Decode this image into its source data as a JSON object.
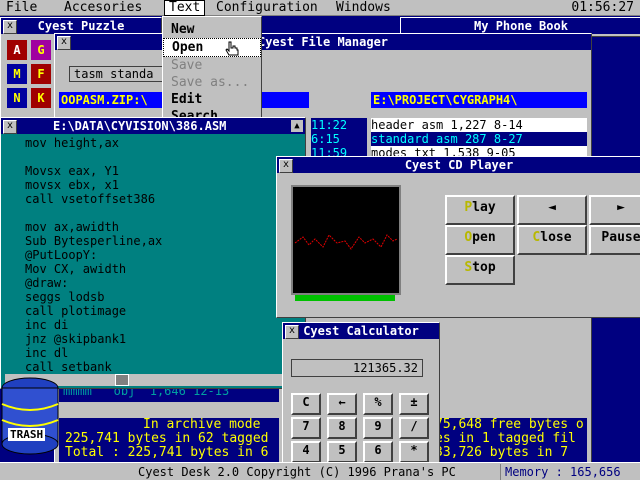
{
  "menubar": {
    "items": [
      {
        "label": "File",
        "hot": "F"
      },
      {
        "label": "Accesories",
        "hot": "A"
      },
      {
        "label": "Text",
        "hot": "T"
      },
      {
        "label": "Configuration",
        "hot": "C"
      },
      {
        "label": "Windows",
        "hot": "W"
      }
    ],
    "clock": "01:56:27"
  },
  "text_menu": {
    "items": [
      {
        "label": "New",
        "enabled": true
      },
      {
        "label": "Open",
        "enabled": true
      },
      {
        "label": "Save",
        "enabled": false
      },
      {
        "label": "Save as...",
        "enabled": false
      },
      {
        "label": "Edit",
        "enabled": true
      },
      {
        "label": "Search",
        "enabled": true
      }
    ]
  },
  "puzzle": {
    "title": "Cyest Puzzle",
    "tiles": [
      "A",
      "G",
      "M",
      "F",
      "N",
      "K"
    ]
  },
  "phonebook": {
    "title": "My Phone Book"
  },
  "file_manager": {
    "title": "Cyest File Manager",
    "path_left": "OOPASM.ZIP:\\",
    "path_right": "E:\\PROJECT\\CYGRAPH4\\",
    "field": "tasm standa",
    "files": [
      {
        "name": "header",
        "ext": "asm",
        "size": "1,227",
        "date": "8-14"
      },
      {
        "name": "standard",
        "ext": "asm",
        "size": "287",
        "date": "8-27"
      },
      {
        "name": "modes",
        "ext": "txt",
        "size": "1,538",
        "date": "9-05"
      }
    ],
    "times": [
      "11:22",
      "6:15",
      "11:59"
    ],
    "bottom_rows": [
      {
        "name": "mmmm",
        "ext": "obj",
        "size": "1,646",
        "date": "12-13"
      }
    ],
    "status_lines": [
      "In archive mode",
      "225,741 bytes in 62 tagged",
      "Total : 225,741 bytes in 6"
    ],
    "status_right": [
      "75,648 free bytes o",
      "es in 1 tagged fil",
      "33,726 bytes in 7"
    ]
  },
  "editor": {
    "title": "E:\\DATA\\CYVISION\\386.ASM",
    "lines": [
      "mov height,ax",
      "",
      "Movsx eax, Y1",
      "movsx ebx, x1",
      "call vsetoffset386",
      "",
      "mov ax,awidth",
      "Sub Bytesperline,ax",
      "@PutLoopY:",
      "Mov CX, awidth",
      "@draw:",
      "seggs lodsb",
      "call plotimage",
      "inc di",
      "jnz @skipbank1",
      "inc dl",
      "call setbank"
    ]
  },
  "cd_player": {
    "title": "Cyest CD Player",
    "buttons": [
      {
        "label": "Play",
        "hot": "P"
      },
      {
        "label": "◄",
        "hot": ""
      },
      {
        "label": "►",
        "hot": ""
      },
      {
        "label": "Open",
        "hot": "O"
      },
      {
        "label": "Close",
        "hot": "C"
      },
      {
        "label": "Pause",
        "hot": ""
      },
      {
        "label": "Stop",
        "hot": "S"
      }
    ]
  },
  "calculator": {
    "title": "Cyest Calculator",
    "display": "121365.32",
    "keys": [
      "C",
      "←",
      "%",
      "±",
      "7",
      "8",
      "9",
      "/",
      "4",
      "5",
      "6",
      "*"
    ]
  },
  "trash": {
    "label": "TRASH"
  },
  "statusbar": {
    "copyright": "Cyest Desk 2.0 Copyright (C) 1996 Prana's PC",
    "memory": "Memory : 165,656"
  },
  "colors": {
    "desktop": "#000080",
    "chrome": "#c0c0c0",
    "title": "#000080",
    "editor": "#008080",
    "accent_yellow": "#ffff00"
  }
}
